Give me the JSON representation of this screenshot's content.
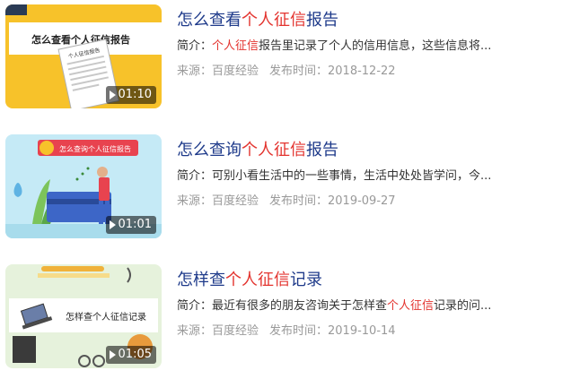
{
  "results": [
    {
      "title_pre": "怎么查看",
      "title_hl": "个人征信",
      "title_post": "报告",
      "desc_label": "简介：",
      "desc_hl": "个人征信",
      "desc_text": "报告里记录了个人的信用信息，这些信息将...",
      "desc_pre": "",
      "source": "来源：百度经验",
      "published": "发布时间：2018-12-22",
      "duration": "01:10",
      "thumb_caption": "怎么查看个人征信报告",
      "thumb_doc_title": "个人征信报告",
      "thumb_corner": "",
      "accent": "#f7c22a"
    },
    {
      "title_pre": "怎么查询",
      "title_hl": "个人征信",
      "title_post": "报告",
      "desc_label": "简介：",
      "desc_pre": "可别小看生活中的一些事情，生活中处处皆学问，今...",
      "desc_hl": "",
      "desc_text": "",
      "source": "来源：百度经验",
      "published": "发布时间：2019-09-27",
      "duration": "01:01",
      "thumb_caption": "怎么查询个人征信报告",
      "accent": "#bfe8f5"
    },
    {
      "title_pre": "怎样查",
      "title_hl": "个人征信",
      "title_post": "记录",
      "desc_label": "简介：",
      "desc_pre": "最近有很多的朋友咨询关于怎样查",
      "desc_hl": "个人征信",
      "desc_text": "记录的问...",
      "source": "来源：百度经验",
      "published": "发布时间：2019-10-14",
      "duration": "01:05",
      "thumb_caption": "怎样查个人征信记录",
      "accent": "#dff0d0"
    }
  ]
}
